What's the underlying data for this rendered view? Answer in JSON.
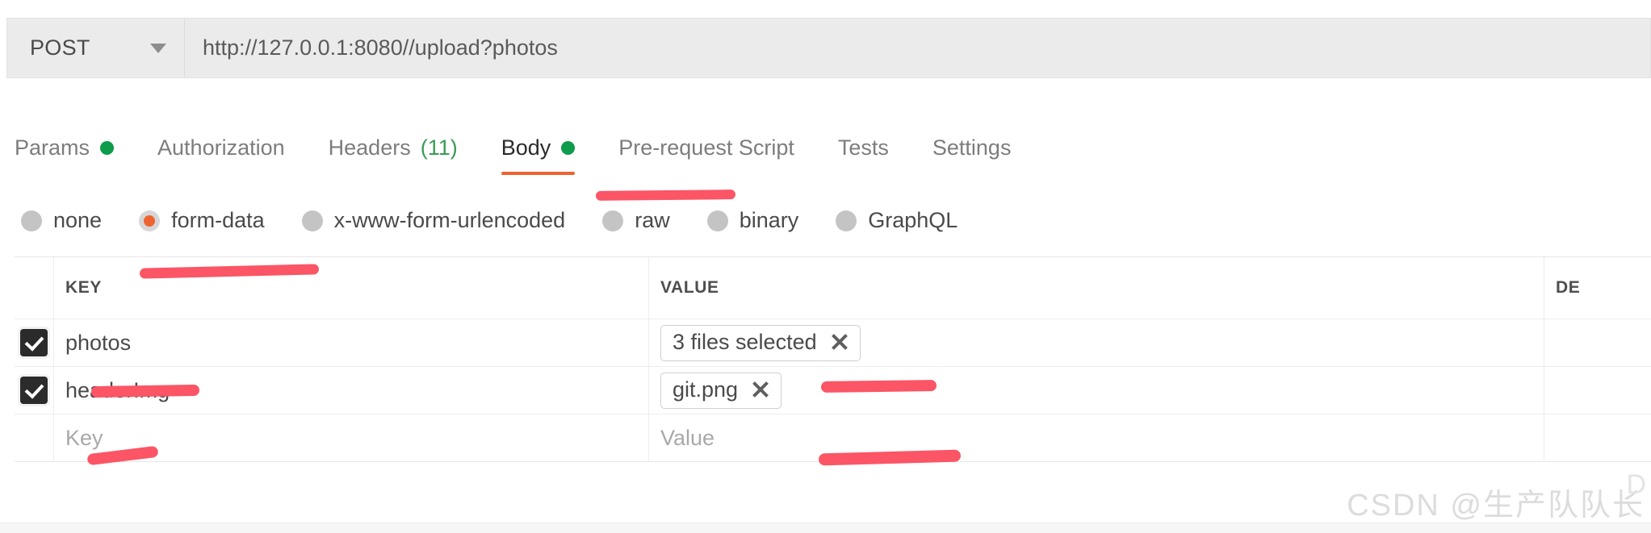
{
  "request": {
    "method": "POST",
    "url": "http://127.0.0.1:8080//upload?photos",
    "caret_icon": "chevron-down-icon"
  },
  "tabs": [
    {
      "label": "Params",
      "has_dot": true,
      "active": false
    },
    {
      "label": "Authorization",
      "has_dot": false,
      "active": false
    },
    {
      "label": "Headers",
      "count": "(11)",
      "has_dot": false,
      "active": false
    },
    {
      "label": "Body",
      "has_dot": true,
      "active": true
    },
    {
      "label": "Pre-request Script",
      "has_dot": false,
      "active": false
    },
    {
      "label": "Tests",
      "has_dot": false,
      "active": false
    },
    {
      "label": "Settings",
      "has_dot": false,
      "active": false
    }
  ],
  "body_types": [
    {
      "label": "none",
      "selected": false
    },
    {
      "label": "form-data",
      "selected": true
    },
    {
      "label": "x-www-form-urlencoded",
      "selected": false
    },
    {
      "label": "raw",
      "selected": false
    },
    {
      "label": "binary",
      "selected": false
    },
    {
      "label": "GraphQL",
      "selected": false
    }
  ],
  "table": {
    "headers": {
      "key": "KEY",
      "value": "VALUE",
      "description": "DE"
    },
    "rows": [
      {
        "checked": true,
        "key": "photos",
        "value_chip": "3 files selected",
        "chip_close_icon": "close-icon"
      },
      {
        "checked": true,
        "key": "headerImg",
        "value_chip": "git.png",
        "chip_close_icon": "close-icon"
      }
    ],
    "empty_row": {
      "key_placeholder": "Key",
      "value_placeholder": "Value"
    }
  },
  "watermark": {
    "text": "CSDN @生产队队长",
    "corner_letter": "D"
  },
  "colors": {
    "accent_orange": "#ef6331",
    "status_green": "#0c9c4b",
    "annotation_red": "#fb5566",
    "checkbox_dark": "#2b2b2b"
  }
}
